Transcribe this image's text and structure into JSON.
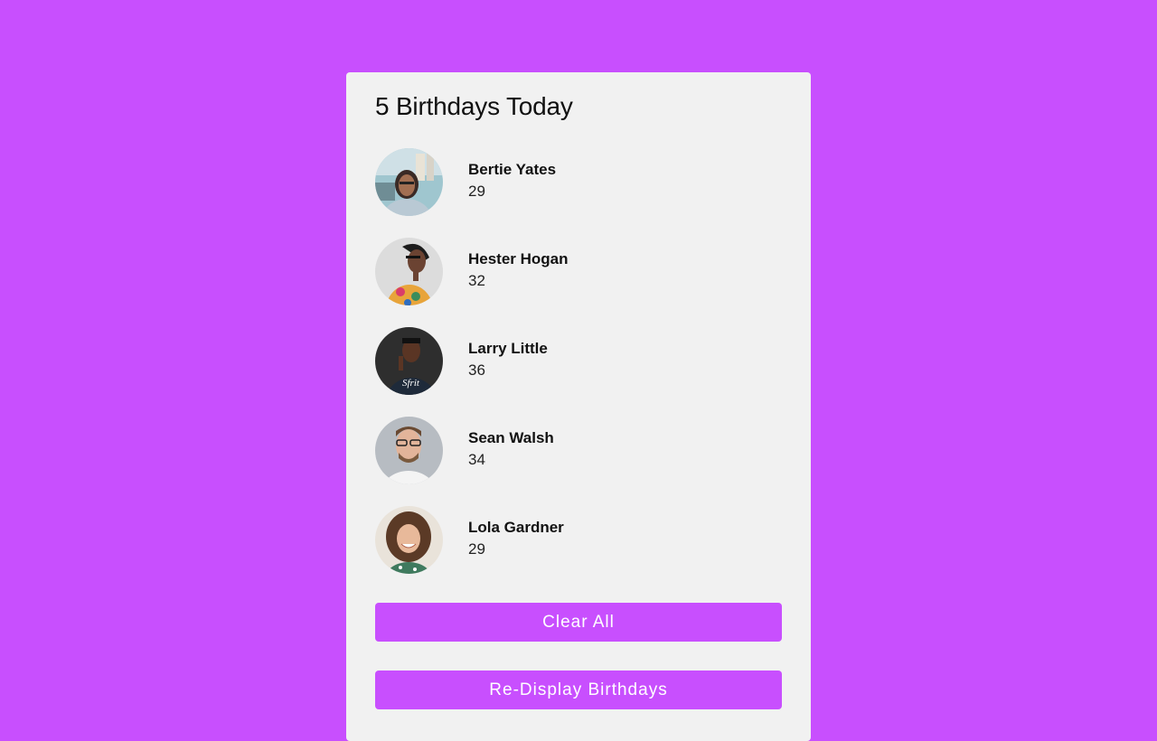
{
  "header": {
    "title": "5 Birthdays Today"
  },
  "people": [
    {
      "name": "Bertie Yates",
      "age": "29",
      "avatar_icon": "woman-portrait-street"
    },
    {
      "name": "Hester Hogan",
      "age": "32",
      "avatar_icon": "woman-portrait-floral"
    },
    {
      "name": "Larry Little",
      "age": "36",
      "avatar_icon": "man-portrait-dark"
    },
    {
      "name": "Sean Walsh",
      "age": "34",
      "avatar_icon": "man-portrait-glasses"
    },
    {
      "name": "Lola Gardner",
      "age": "29",
      "avatar_icon": "woman-portrait-curly"
    }
  ],
  "actions": {
    "clear_label": "Clear All",
    "redisplay_label": "Re-Display Birthdays"
  },
  "colors": {
    "background": "#c84ffe",
    "card": "#f1f1f1",
    "button": "#c84ffe",
    "button_text": "#ffffff"
  }
}
